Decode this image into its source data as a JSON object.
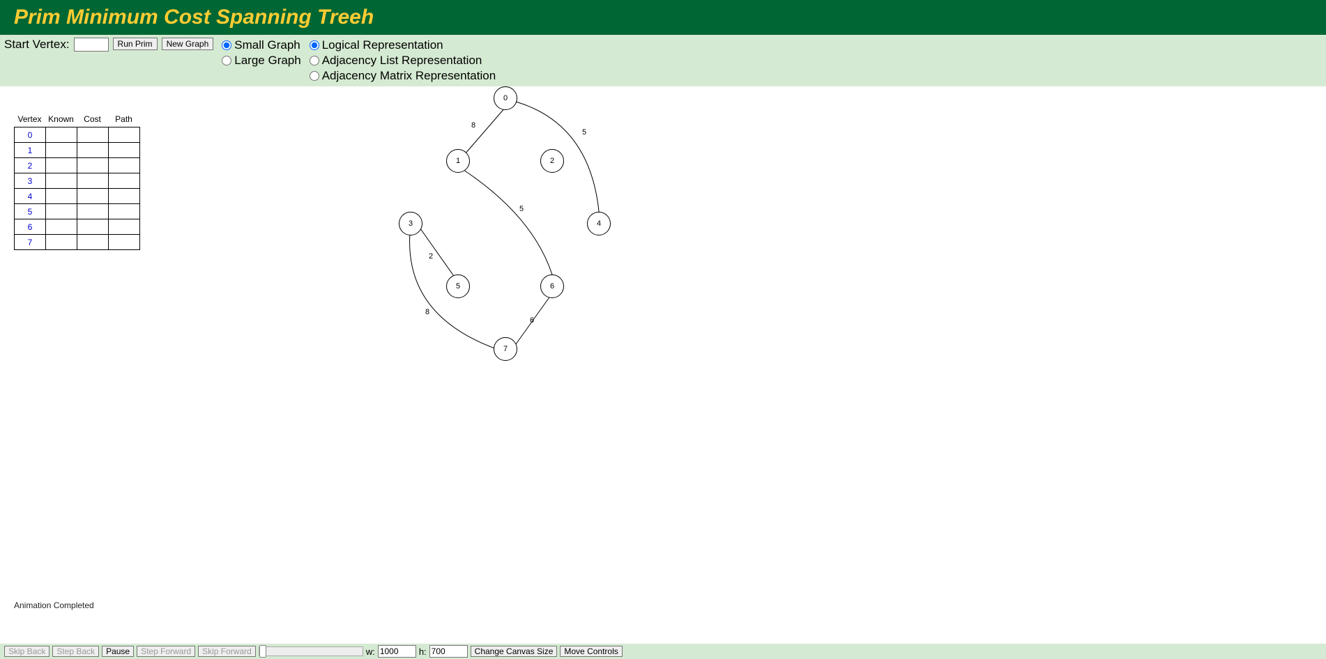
{
  "header": {
    "title": "Prim Minimum Cost Spanning Treeh"
  },
  "controls": {
    "start_label": "Start Vertex:",
    "start_value": "",
    "run_btn": "Run Prim",
    "new_btn": "New Graph",
    "size_small": "Small Graph",
    "size_large": "Large Graph",
    "rep_logical": "Logical Representation",
    "rep_adjlist": "Adjacency List Representation",
    "rep_adjmat": "Adjacency Matrix Representation"
  },
  "table": {
    "headers": {
      "vertex": "Vertex",
      "known": "Known",
      "cost": "Cost",
      "path": "Path"
    },
    "rows": [
      {
        "v": "0",
        "k": "",
        "c": "",
        "p": ""
      },
      {
        "v": "1",
        "k": "",
        "c": "",
        "p": ""
      },
      {
        "v": "2",
        "k": "",
        "c": "",
        "p": ""
      },
      {
        "v": "3",
        "k": "",
        "c": "",
        "p": ""
      },
      {
        "v": "4",
        "k": "",
        "c": "",
        "p": ""
      },
      {
        "v": "5",
        "k": "",
        "c": "",
        "p": ""
      },
      {
        "v": "6",
        "k": "",
        "c": "",
        "p": ""
      },
      {
        "v": "7",
        "k": "",
        "c": "",
        "p": ""
      }
    ]
  },
  "graph": {
    "nodes": {
      "n0": "0",
      "n1": "1",
      "n2": "2",
      "n3": "3",
      "n4": "4",
      "n5": "5",
      "n6": "6",
      "n7": "7"
    },
    "edge_labels": {
      "e01": "8",
      "e02": "5",
      "e16": "5",
      "e35": "2",
      "e37": "8",
      "e67": "6"
    }
  },
  "status": "Animation Completed",
  "bottom": {
    "skip_back": "Skip Back",
    "step_back": "Step Back",
    "pause": "Pause",
    "step_fwd": "Step Forward",
    "skip_fwd": "Skip Forward",
    "w_label": "w:",
    "w_value": "1000",
    "h_label": "h:",
    "h_value": "700",
    "change_size": "Change Canvas Size",
    "move_ctrl": "Move Controls"
  }
}
